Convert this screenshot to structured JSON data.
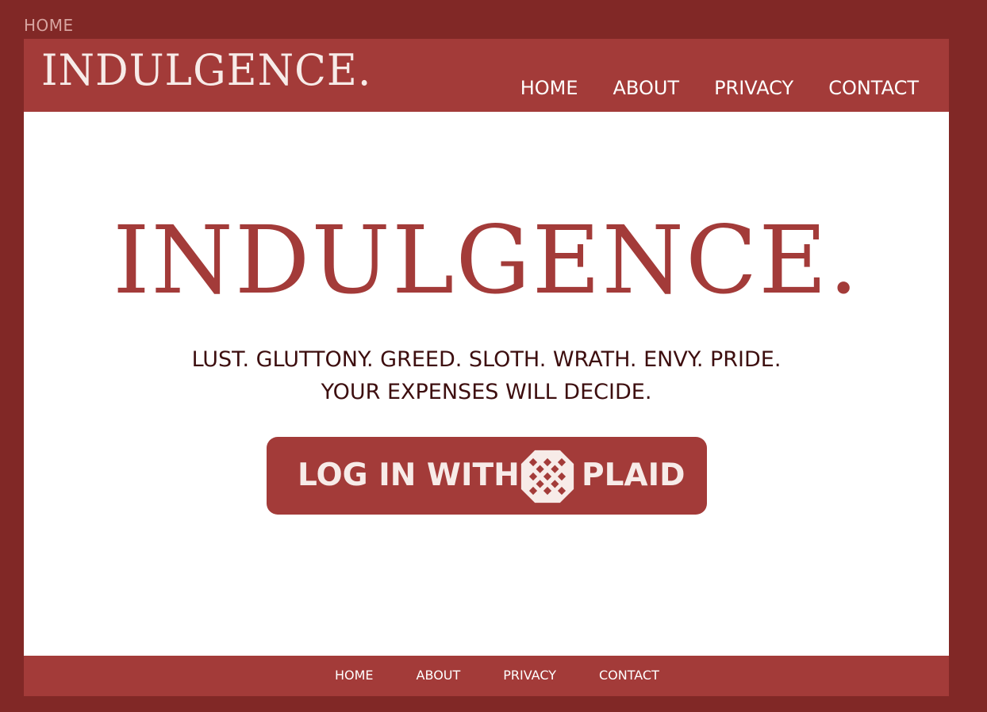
{
  "browser": {
    "tab_title": "HOME"
  },
  "header": {
    "logo_text": "INDULGENCE.",
    "nav": [
      {
        "label": "HOME"
      },
      {
        "label": "ABOUT"
      },
      {
        "label": "PRIVACY"
      },
      {
        "label": "CONTACT"
      }
    ]
  },
  "hero": {
    "title": "INDULGENCE.",
    "tagline_line1": "LUST. GLUTTONY. GREED. SLOTH. WRATH. ENVY. PRIDE.",
    "tagline_line2": "YOUR EXPENSES WILL DECIDE.",
    "login_button": {
      "prefix": "LOG IN WITH",
      "brand": "PLAID",
      "icon": "plaid-logo"
    }
  },
  "footer": {
    "nav": [
      {
        "label": "HOME"
      },
      {
        "label": "ABOUT"
      },
      {
        "label": "PRIVACY"
      },
      {
        "label": "CONTACT"
      }
    ]
  },
  "colors": {
    "outer_bg": "#812826",
    "brand_red": "#a33b39",
    "text_dark": "#3d0e0f",
    "light_text": "#f7ebe8"
  }
}
